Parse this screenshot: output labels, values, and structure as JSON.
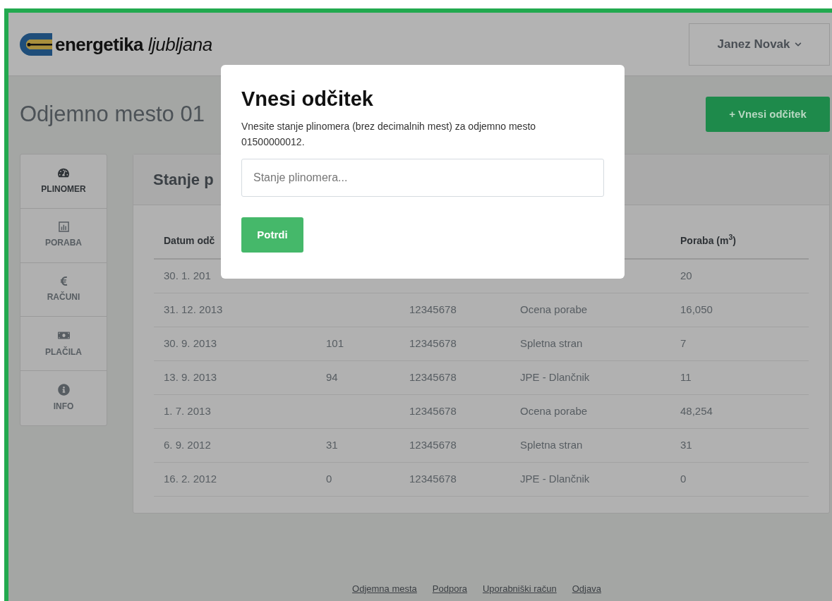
{
  "header": {
    "logo_bold": "energetika",
    "logo_light": "ljubljana",
    "user_menu": "Janez Novak"
  },
  "page": {
    "title": "Odjemno mesto 01",
    "add_button": "+ Vnesi odčitek"
  },
  "sidebar": {
    "items": [
      {
        "label": "PLINOMER",
        "selected": true
      },
      {
        "label": "PORABA",
        "selected": false
      },
      {
        "label": "RAČUNI",
        "selected": false
      },
      {
        "label": "PLAČILA",
        "selected": false
      },
      {
        "label": "INFO",
        "selected": false
      }
    ]
  },
  "panel": {
    "title": "Stanje p",
    "table": {
      "columns": [
        "Datum odč",
        "",
        "",
        "",
        "Poraba (m$^{3}$)"
      ],
      "rows": [
        [
          "30. 1. 201",
          "",
          "",
          "",
          "20"
        ],
        [
          "31. 12. 2013",
          "",
          "12345678",
          "Ocena porabe",
          "16,050"
        ],
        [
          "30. 9. 2013",
          "101",
          "12345678",
          "Spletna stran",
          "7"
        ],
        [
          "13. 9. 2013",
          "94",
          "12345678",
          "JPE - Dlančnik",
          "11"
        ],
        [
          "1. 7. 2013",
          "",
          "12345678",
          "Ocena porabe",
          "48,254"
        ],
        [
          "6. 9. 2012",
          "31",
          "12345678",
          "Spletna stran",
          "31"
        ],
        [
          "16. 2. 2012",
          "0",
          "12345678",
          "JPE - Dlančnik",
          "0"
        ]
      ]
    }
  },
  "footer": {
    "links": [
      "Odjemna mesta",
      "Podpora",
      "Uporabniški račun",
      "Odjava"
    ]
  },
  "modal": {
    "title": "Vnesi odčitek",
    "text": "Vnesite stanje plinomera (brez decimalnih mest) za odjemno mesto 01500000012.",
    "placeholder": "Stanje plinomera...",
    "button": "Potrdi"
  }
}
